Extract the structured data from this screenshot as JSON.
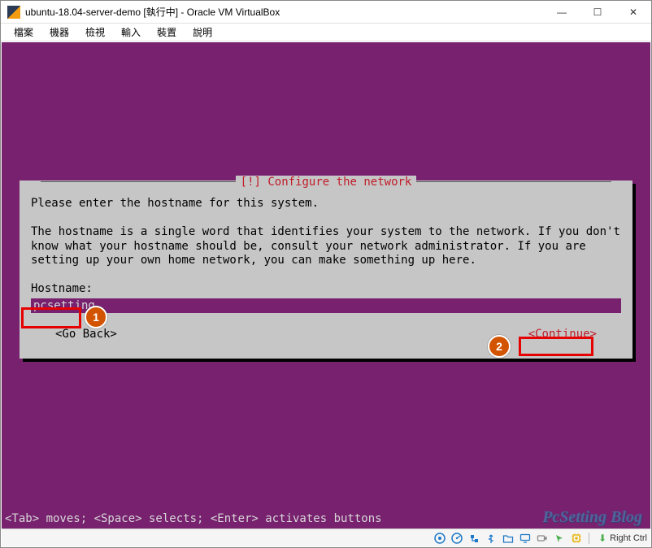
{
  "window": {
    "title": "ubuntu-18.04-server-demo [執行中] - Oracle VM VirtualBox",
    "buttons": {
      "minimize": "—",
      "maximize": "☐",
      "close": "✕"
    }
  },
  "menubar": {
    "items": [
      "檔案",
      "機器",
      "檢視",
      "輸入",
      "裝置",
      "說明"
    ]
  },
  "dialog": {
    "title": "[!] Configure the network",
    "prompt": "Please enter the hostname for this system.",
    "description": "The hostname is a single word that identifies your system to the network. If you don't know what your hostname should be, consult your network administrator. If you are setting up your own home network, you can make something up here.",
    "field_label": "Hostname:",
    "field_value": "pcsetting",
    "go_back": "<Go Back>",
    "continue": "<Continue>"
  },
  "annotations": {
    "label1": "1",
    "label2": "2"
  },
  "hint": "<Tab> moves; <Space> selects; <Enter> activates buttons",
  "watermark": "PcSetting Blog",
  "statusbar": {
    "hostkey": "Right Ctrl",
    "icons": [
      "disc",
      "hdd",
      "net",
      "usb",
      "shared",
      "display",
      "record",
      "vrde",
      "cpu"
    ]
  }
}
